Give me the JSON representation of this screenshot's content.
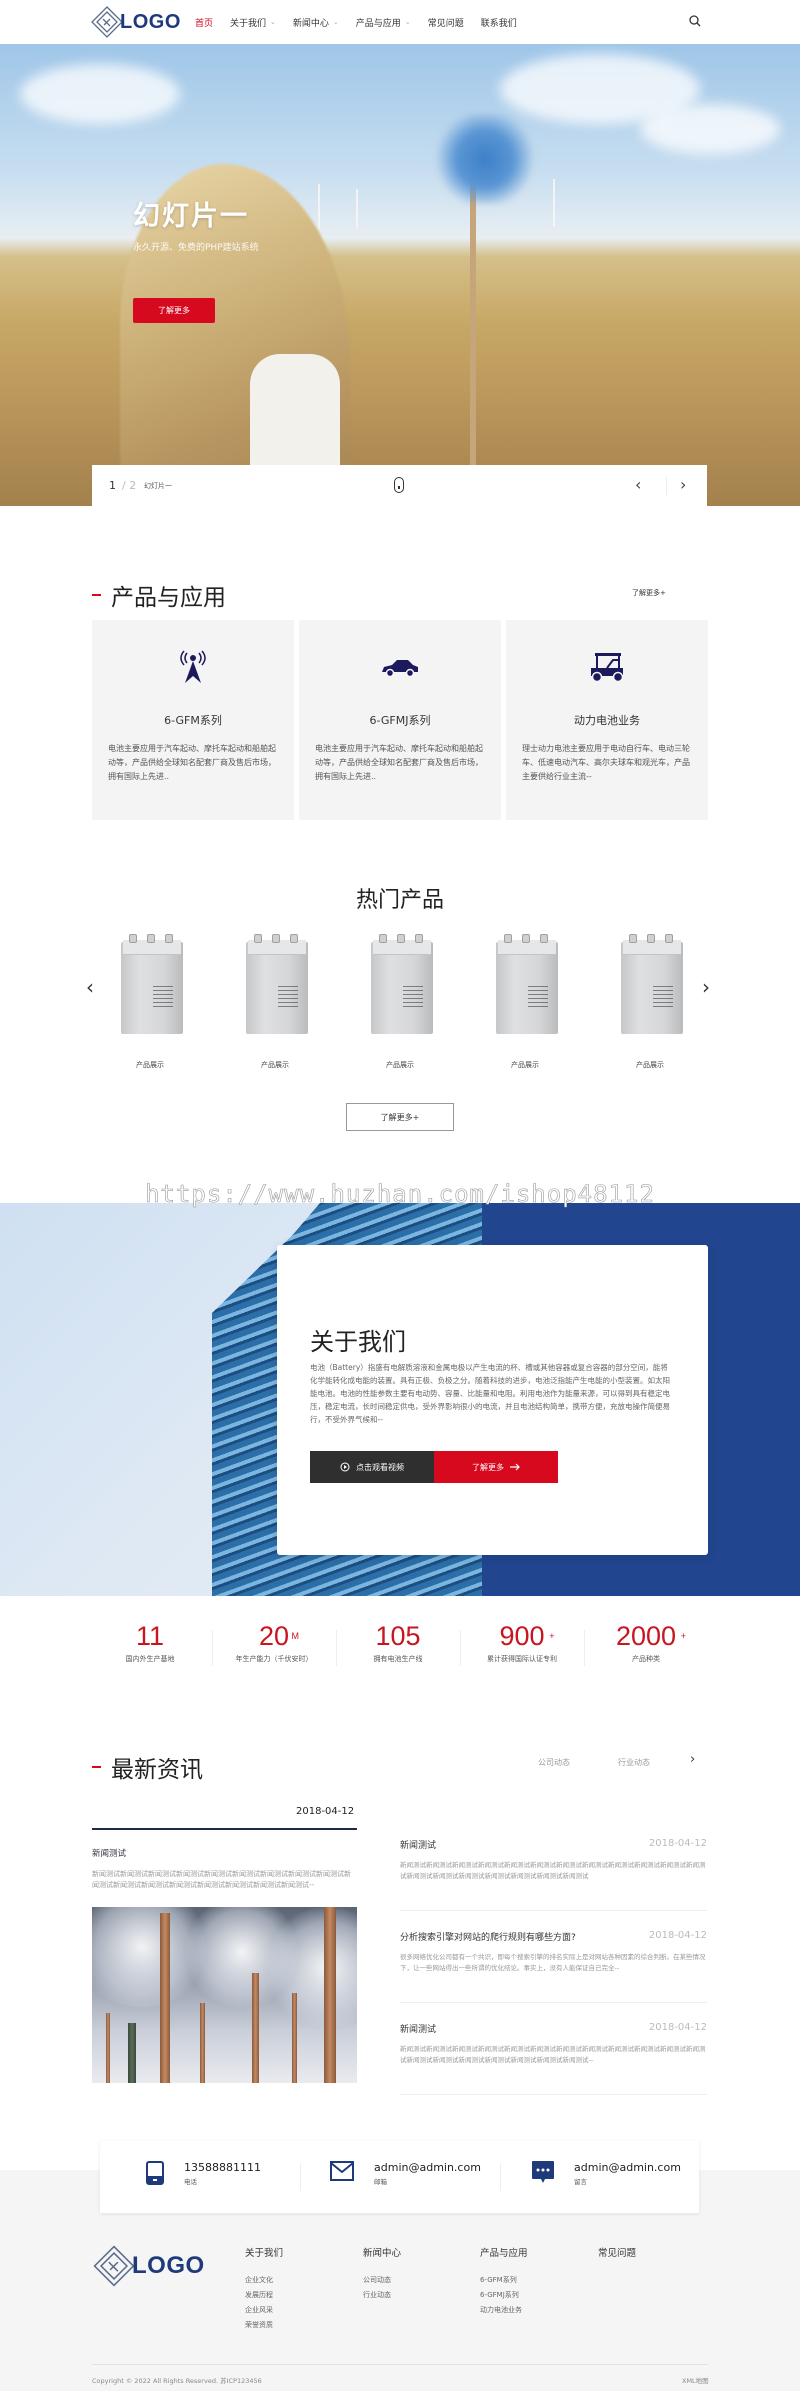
{
  "header": {
    "logo_text": "LOGO",
    "nav": [
      {
        "label": "首页",
        "active": true,
        "has_dropdown": false
      },
      {
        "label": "关于我们",
        "has_dropdown": true
      },
      {
        "label": "新闻中心",
        "has_dropdown": true
      },
      {
        "label": "产品与应用",
        "has_dropdown": true
      },
      {
        "label": "常见问题",
        "has_dropdown": false
      },
      {
        "label": "联系我们",
        "has_dropdown": false
      }
    ],
    "chevron": "⌄",
    "search_icon": "search-icon"
  },
  "hero": {
    "title": "幻灯片一",
    "subtitle": "永久开源、免费的PHP建站系统",
    "button": "了解更多",
    "current_slide": "1",
    "total_slides": "/ 2",
    "slide_name": "幻灯片一",
    "prev": "‹",
    "next": "›"
  },
  "products_section": {
    "title": "产品与应用",
    "more": "了解更多+",
    "cards": [
      {
        "icon": "signal-tower-icon",
        "title": "6-GFM系列",
        "desc": "电池主要应用于汽车起动、摩托车起动和船舶起动等，产品供给全球知名配套厂商及售后市场，拥有国际上先进.."
      },
      {
        "icon": "car-icon",
        "title": "6-GFMJ系列",
        "desc": "电池主要应用于汽车起动、摩托车起动和船舶起动等，产品供给全球知名配套厂商及售后市场，拥有国际上先进.."
      },
      {
        "icon": "golf-cart-icon",
        "title": "动力电池业务",
        "desc": "理士动力电池主要应用于电动自行车、电动三轮车、低速电动汽车、高尔夫球车和观光车，产品主要供给行业主流--"
      }
    ]
  },
  "hot_products": {
    "title": "热门产品",
    "items": [
      {
        "caption": "产品展示"
      },
      {
        "caption": "产品展示"
      },
      {
        "caption": "产品展示"
      },
      {
        "caption": "产品展示"
      },
      {
        "caption": "产品展示"
      }
    ],
    "prev": "‹",
    "next": "›",
    "more": "了解更多+"
  },
  "watermark": "https://www.huzhan.com/ishop48112",
  "about": {
    "title": "关于我们",
    "text": "电池（Battery）指盛有电解质溶液和金属电极以产生电流的杯、槽或其他容器或复合容器的部分空间，能将化学能转化成电能的装置。具有正极、负极之分。随着科技的进步，电池泛指能产生电能的小型装置。如太阳能电池。电池的性能参数主要有电动势、容量、比能量和电阻。利用电池作为能量来源，可以得到具有稳定电压，稳定电流，长时间稳定供电，受外界影响很小的电流，并且电池结构简单，携带方便，充放电操作简便易行，不受外界气候和--",
    "video_button": "点击观看视频",
    "more_button": "了解更多"
  },
  "stats": [
    {
      "value": "11",
      "sup": "",
      "label": "国内外生产基地"
    },
    {
      "value": "20",
      "sup": "M",
      "label": "年生产能力（千伏安时）"
    },
    {
      "value": "105",
      "sup": "",
      "label": "拥有电池生产线"
    },
    {
      "value": "900",
      "sup": "+",
      "label": "累计获得国际认证专利"
    },
    {
      "value": "2000",
      "sup": "+",
      "label": "产品种类"
    }
  ],
  "news": {
    "title": "最新资讯",
    "tabs": [
      "公司动态",
      "行业动态"
    ],
    "next": "›",
    "featured": {
      "date": "2018-04-12",
      "title": "新闻测试",
      "desc": "新闻测试新闻测试新闻测试新闻测试新闻测试新闻测试新闻测试新闻测试新闻测试新闻测试新闻测试新闻测试新闻测试新闻测试新闻测试新闻测试新闻测试--"
    },
    "items": [
      {
        "title": "新闻测试",
        "date": "2018-04-12",
        "desc": "新闻测试新闻测试新闻测试新闻测试新闻测试新闻测试新闻测试新闻测试新闻测试新闻测试新闻测试新闻测试新闻测试新闻测试新闻测试新闻测试新闻测试新闻测试新闻测试"
      },
      {
        "title": "分析搜索引擎对网站的爬行规则有哪些方面?",
        "date": "2018-04-12",
        "desc": "很多网络优化公司都有一个共识，即每个搜索引擎的排名实际上是对网站各种因素的综合判断。在某些情况下，让一些网站得出一些所谓的优化结论。事实上，没有人能保证自己完全--"
      },
      {
        "title": "新闻测试",
        "date": "2018-04-12",
        "desc": "新闻测试新闻测试新闻测试新闻测试新闻测试新闻测试新闻测试新闻测试新闻测试新闻测试新闻测试新闻测试新闻测试新闻测试新闻测试新闻测试新闻测试新闻测试新闻测试--"
      }
    ]
  },
  "contact": [
    {
      "icon": "phone-icon",
      "value": "13588881111",
      "label": "电话"
    },
    {
      "icon": "mail-icon",
      "value": "admin@admin.com",
      "label": "邮箱"
    },
    {
      "icon": "message-icon",
      "value": "admin@admin.com",
      "label": "留言"
    }
  ],
  "footer": {
    "logo_text": "LOGO",
    "columns": [
      {
        "title": "关于我们",
        "links": [
          "企业文化",
          "发展历程",
          "企业风采",
          "荣誉资质"
        ]
      },
      {
        "title": "新闻中心",
        "links": [
          "公司动态",
          "行业动态"
        ]
      },
      {
        "title": "产品与应用",
        "links": [
          "6-GFM系列",
          "6-GFMJ系列",
          "动力电池业务"
        ]
      },
      {
        "title": "常见问题",
        "links": []
      }
    ],
    "copyright": "Copyright © 2022 All Rights Reserved. 苏ICP123456",
    "sitemap": "XML地图"
  },
  "colors": {
    "accent_red": "#d7091f",
    "brand_navy": "#21458f",
    "stat_red": "#c8151f"
  }
}
